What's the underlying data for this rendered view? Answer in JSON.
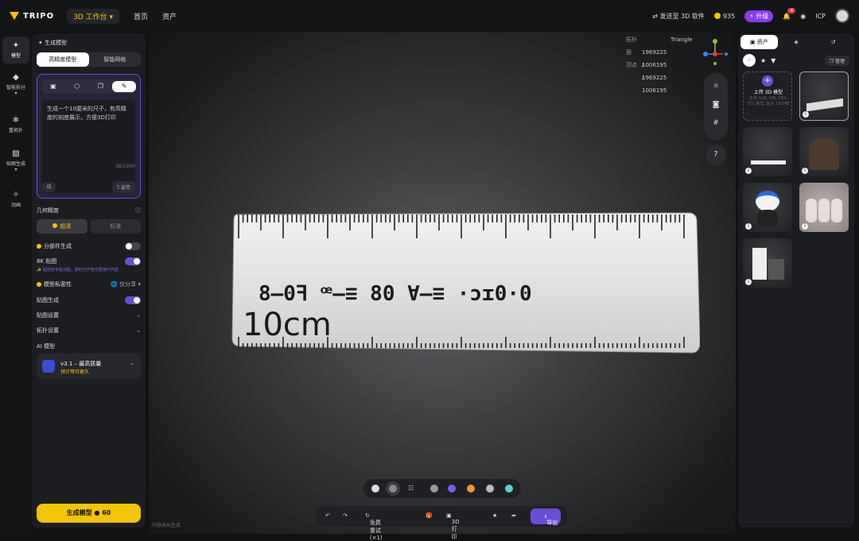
{
  "topbar": {
    "brand": "TRIPO",
    "workspace": "3D 工作台",
    "nav_home": "首页",
    "nav_assets": "资产",
    "send_to": "发送至 3D 软件",
    "credits": "935",
    "upgrade": "升级",
    "notif_count": "4",
    "icp": "ICP"
  },
  "rail": {
    "items": [
      {
        "label": "模型",
        "icon": "✦"
      },
      {
        "label": "智能拆分",
        "icon": "◆"
      },
      {
        "label": "重拓扑",
        "icon": "❄"
      },
      {
        "label": "贴图生成",
        "icon": "▨"
      },
      {
        "label": "动画",
        "icon": "✧"
      }
    ]
  },
  "panel": {
    "title": "生成模型",
    "tab_hd": "高精度模型",
    "tab_smart": "智能网格",
    "prompt_text": "生成一个10厘米的尺子，有高精度的刻度展示，方便3D打印",
    "char_count": "28/1000",
    "tpose": "T-姿势",
    "geo_label": "几何精度",
    "geo_ultra": "超清",
    "geo_std": "标准",
    "part_gen": "分部件生成",
    "tex8k": "8K 贴图",
    "tex8k_note": "✨ 提前抢专属功能，即时分开有付费用户开放",
    "privacy": "模型私密性",
    "privacy_value": "仅分享",
    "tex_gen": "贴图生成",
    "tex_settings": "贴图设置",
    "topo_settings": "拓扑设置",
    "ai_model": "AI 模型",
    "model_name": "v3.1 – 最高质量",
    "model_sub": "预计等待更久",
    "generate": "生成模型",
    "generate_cost": "60"
  },
  "viewport": {
    "topo_label": "拓扑",
    "topo_value": "Triangle",
    "faces_label": "面",
    "faces_value": "1969225 / 1969225",
    "verts_label": "顶点",
    "verts_value": "1006195 / 1006195",
    "help": "?",
    "ruler_text": "10cm",
    "ruler_symbols": "8—0ꟻ ꟹ—≡ 80 ∀—≡ ·ɔɪ0·0",
    "retry": "免费重试 (×1)",
    "print3d": "3D 打印",
    "export": "导出",
    "footer_note": "内容由AI生成"
  },
  "assets": {
    "tab_assets": "资产",
    "manage": "管理",
    "upload_title": "上传 3D 模型",
    "upload_sub": "支持 GLB, OBJ, FBX, STL 格式, 最大 100MB"
  },
  "colors": {
    "accent_yellow": "#f5c400",
    "accent_purple": "#6a4ed8"
  }
}
